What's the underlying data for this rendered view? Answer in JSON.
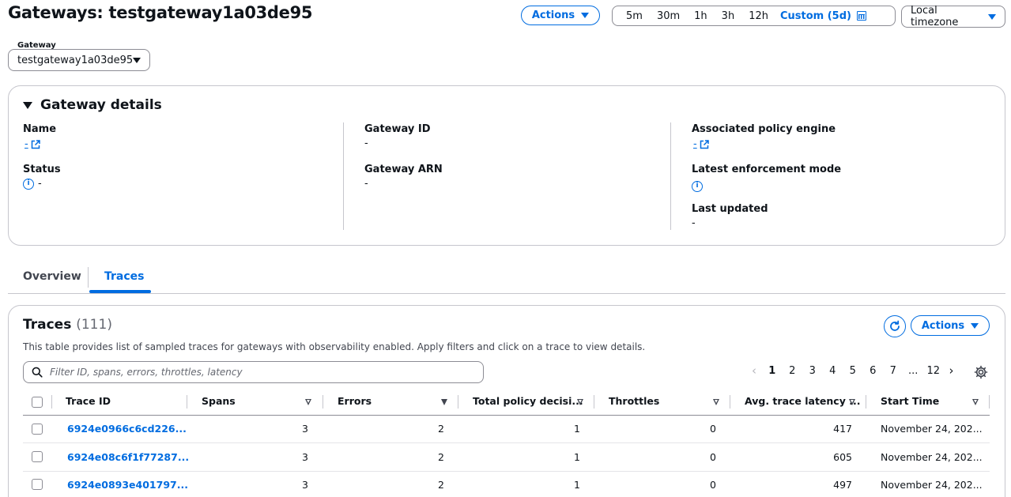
{
  "header": {
    "title": "Gateways: testgateway1a03de95",
    "actions_label": "Actions",
    "time_ranges": [
      "5m",
      "30m",
      "1h",
      "3h",
      "12h"
    ],
    "custom_range_label": "Custom (5d)",
    "timezone_label": "Local timezone"
  },
  "gateway_select": {
    "label": "Gateway",
    "value": "testgateway1a03de95"
  },
  "details": {
    "heading": "Gateway details",
    "name_key": "Name",
    "name_value": "-",
    "status_key": "Status",
    "status_value": "-",
    "gateway_id_key": "Gateway ID",
    "gateway_id_value": "-",
    "gateway_arn_key": "Gateway ARN",
    "gateway_arn_value": "-",
    "policy_engine_key": "Associated policy engine",
    "policy_engine_value": "-",
    "enforcement_key": "Latest enforcement mode",
    "last_updated_key": "Last updated",
    "last_updated_value": "-"
  },
  "tabs": [
    {
      "label": "Overview",
      "active": false
    },
    {
      "label": "Traces",
      "active": true
    }
  ],
  "traces": {
    "title": "Traces",
    "count": "(111)",
    "description": "This table provides list of sampled traces for gateways with observability enabled. Apply filters and click on a trace to view details.",
    "actions_label": "Actions",
    "search_placeholder": "Filter ID, spans, errors, throttles, latency",
    "pagination": {
      "pages": [
        "1",
        "2",
        "3",
        "4",
        "5",
        "6",
        "7",
        "...",
        "12"
      ],
      "current": "1"
    },
    "columns": [
      "Trace ID",
      "Spans",
      "Errors",
      "Total policy decisi...",
      "Throttles",
      "Avg. trace latency ...",
      "Start Time"
    ],
    "rows": [
      {
        "trace_id": "6924e0966c6cd226...",
        "spans": "3",
        "errors": "2",
        "policy": "1",
        "throttles": "0",
        "latency": "417",
        "start": "November 24, 202..."
      },
      {
        "trace_id": "6924e08c6f1f77287...",
        "spans": "3",
        "errors": "2",
        "policy": "1",
        "throttles": "0",
        "latency": "605",
        "start": "November 24, 202..."
      },
      {
        "trace_id": "6924e0893e401797...",
        "spans": "3",
        "errors": "2",
        "policy": "1",
        "throttles": "0",
        "latency": "497",
        "start": "November 24, 202..."
      }
    ]
  },
  "colors": {
    "accent": "#006ce0",
    "text": "#0f141a",
    "border": "#c6c6cd"
  }
}
